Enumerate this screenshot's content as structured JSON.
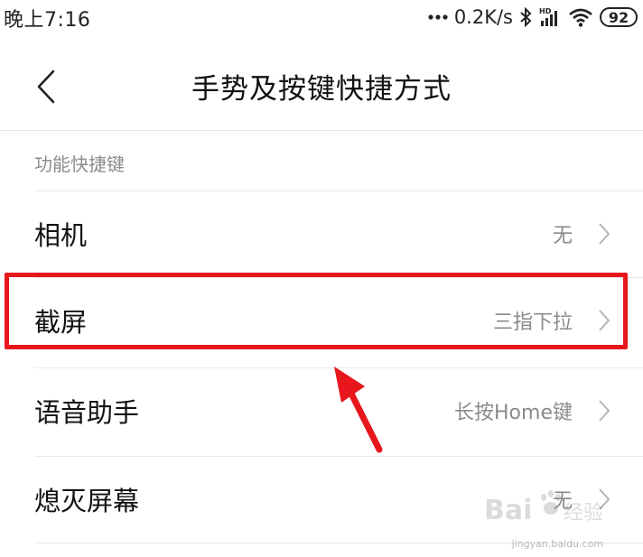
{
  "status_bar": {
    "time": "晚上7:16",
    "network_speed": "0.2K/s",
    "battery": "92",
    "icons": [
      "more-dots-icon",
      "bluetooth-icon",
      "hd-signal-icon",
      "wifi-icon",
      "battery-icon"
    ]
  },
  "header": {
    "title": "手势及按键快捷方式",
    "back_icon": "chevron-left-icon"
  },
  "section": {
    "label": "功能快捷键"
  },
  "rows": [
    {
      "label": "相机",
      "value": "无"
    },
    {
      "label": "截屏",
      "value": "三指下拉"
    },
    {
      "label": "语音助手",
      "value": "长按Home键"
    },
    {
      "label": "熄灭屏幕",
      "value": "无"
    }
  ],
  "annotation": {
    "highlight_color": "#e8161d"
  },
  "watermark": {
    "text": "Baidu经验",
    "subtext": "jingyan.baidu.com"
  }
}
